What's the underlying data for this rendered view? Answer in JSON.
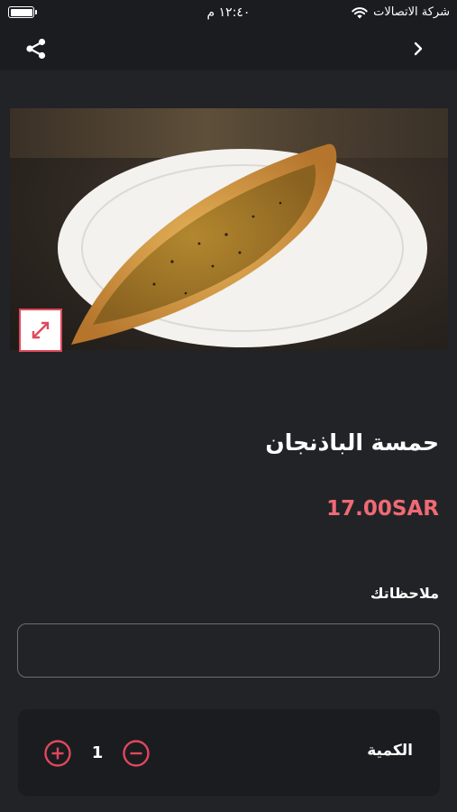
{
  "status_bar": {
    "carrier": "شركة الاتصالات",
    "time": "١٢:٤٠ م"
  },
  "product": {
    "name": "حمسة الباذنجان",
    "price": "17.00SAR",
    "image_icon": "product-photo"
  },
  "notes": {
    "label": "ملاحظاتك",
    "value": "",
    "placeholder": ""
  },
  "quantity": {
    "label": "الكمية",
    "value": "1"
  },
  "icons": {
    "share": "share-icon",
    "back": "chevron-right-icon",
    "expand": "expand-icon",
    "plus": "plus-circle-icon",
    "minus": "minus-circle-icon"
  },
  "colors": {
    "background": "#222327",
    "bar": "#1b1c1f",
    "accent": "#e0485c",
    "price": "#ef6a74"
  }
}
